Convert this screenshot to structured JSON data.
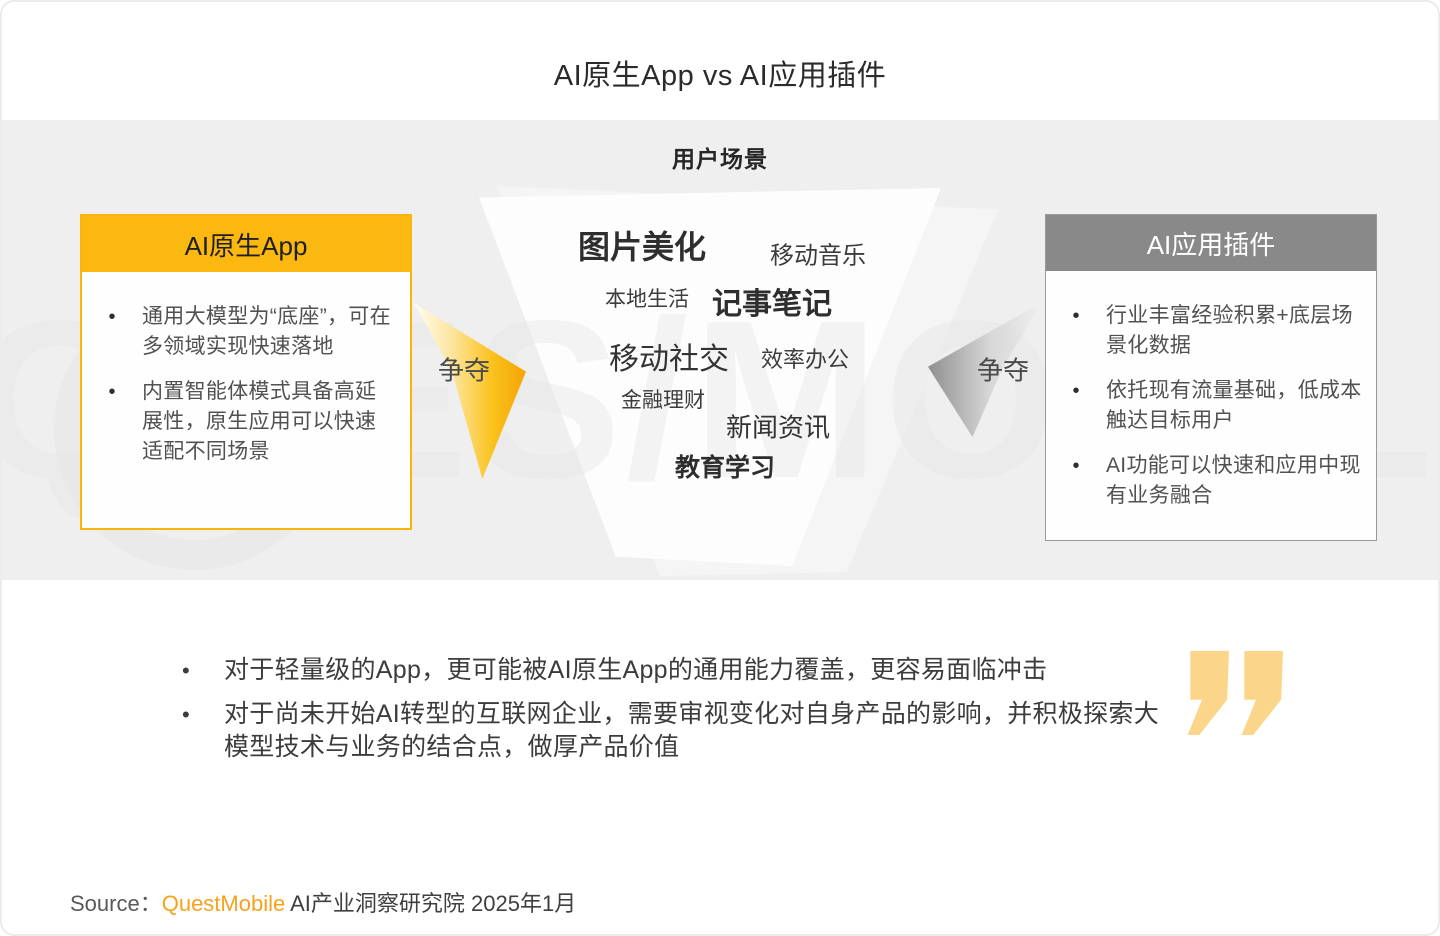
{
  "title": "AI原生App vs AI应用插件",
  "scene_heading": "用户场景",
  "left_box": {
    "title": "AI原生App",
    "bullet_glyph": "•",
    "bullets": [
      "通用大模型为“底座”，可在多领域实现快速落地",
      "内置智能体模式具备高延展性，原生应用可以快速适配不同场景"
    ]
  },
  "right_box": {
    "title": "AI应用插件",
    "bullet_glyph": "•",
    "bullets": [
      "行业丰富经验积累+底层场景化数据",
      "依托现有流量基础，低成本触达目标用户",
      "AI功能可以快速和应用中现有业务融合"
    ]
  },
  "arrows": {
    "left_label": "争夺",
    "right_label": "争夺"
  },
  "funnel": {
    "items": [
      {
        "label": "图片美化"
      },
      {
        "label": "移动音乐"
      },
      {
        "label": "本地生活"
      },
      {
        "label": "记事笔记"
      },
      {
        "label": "移动社交"
      },
      {
        "label": "效率办公"
      },
      {
        "label": "金融理财"
      },
      {
        "label": "新闻资讯"
      },
      {
        "label": "教育学习"
      }
    ]
  },
  "insights": {
    "bullet_glyph": "•",
    "items": [
      "对于轻量级的App，更可能被AI原生App的通用能力覆盖，更容易面临冲击",
      "对于尚未开始AI转型的互联网企业，需要审视变化对自身产品的影响，并积极探索大模型技术与业务的结合点，做厚产品价值"
    ]
  },
  "watermark_text": "QUES/MOBILE",
  "source": {
    "label": "Source：",
    "brand": "QuestMobile",
    "suffix": " AI产业洞察研究院 2025年1月"
  },
  "colors": {
    "accent_yellow": "#FBB811",
    "header_gray": "#898989",
    "band_gray": "#EFEFEF",
    "brand_orange": "#F7A21C",
    "quote_yellow": "#FBD68A"
  }
}
